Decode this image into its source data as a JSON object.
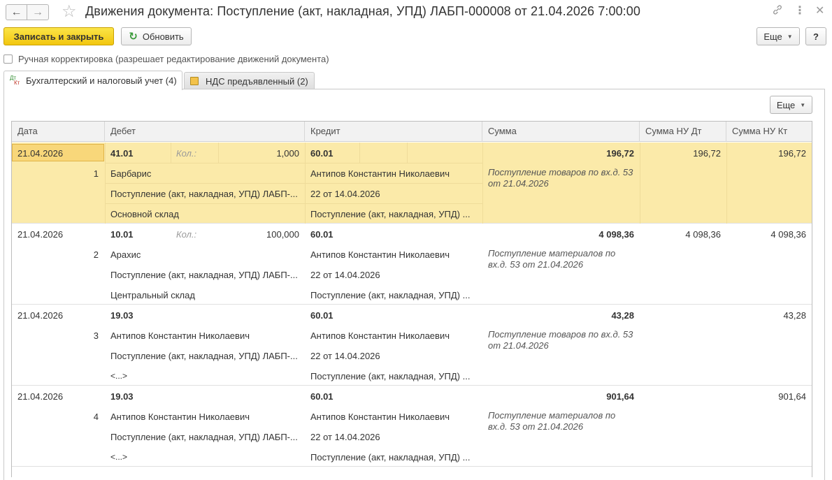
{
  "window": {
    "title": "Движения документа: Поступление (акт, накладная, УПД) ЛАБП-000008 от 21.04.2026 7:00:00",
    "back_glyph": "←",
    "forward_glyph": "→",
    "icons": [
      "favorite-star-icon",
      "link-icon",
      "more-vertical-icon",
      "close-icon"
    ]
  },
  "toolbar": {
    "save_close_label": "Записать и закрыть",
    "refresh_label": "Обновить",
    "more_label": "Еще",
    "help_label": "?"
  },
  "manual_correction": {
    "label": "Ручная корректировка (разрешает редактирование движений документа)",
    "checked": false
  },
  "tabs": [
    {
      "label": "Бухгалтерский и налоговый учет (4)",
      "icon_d": "Дт",
      "icon_k": "Кт",
      "active": true
    },
    {
      "label": "НДС предъявленный (2)",
      "active": false
    }
  ],
  "table_toolbar": {
    "more_label": "Еще"
  },
  "columns": {
    "date": "Дата",
    "debit": "Дебет",
    "credit": "Кредит",
    "sum": "Сумма",
    "sum_nu_dt": "Сумма НУ Дт",
    "sum_nu_kt": "Сумма НУ Кт"
  },
  "rows": [
    {
      "date": "21.04.2026",
      "num": "1",
      "debit_account": "41.01",
      "qty_label": "Кол.:",
      "qty": "1,000",
      "debit_sub1": "Барбарис",
      "debit_sub2": "Поступление (акт, накладная, УПД) ЛАБП-...",
      "debit_sub3": "Основной склад",
      "credit_account": "60.01",
      "credit_sub1": "Антипов Константин Николаевич",
      "credit_sub2": "22 от 14.04.2026",
      "credit_sub3": "Поступление (акт, накладная, УПД) ...",
      "sum": "196,72",
      "content": "Поступление товаров по вх.д. 53 от 21.04.2026",
      "sum_nu_dt": "196,72",
      "sum_nu_kt": "196,72",
      "selected": true
    },
    {
      "date": "21.04.2026",
      "num": "2",
      "debit_account": "10.01",
      "qty_label": "Кол.:",
      "qty": "100,000",
      "debit_sub1": "Арахис",
      "debit_sub2": "Поступление (акт, накладная, УПД) ЛАБП-...",
      "debit_sub3": "Центральный склад",
      "credit_account": "60.01",
      "credit_sub1": "Антипов Константин Николаевич",
      "credit_sub2": "22 от 14.04.2026",
      "credit_sub3": "Поступление (акт, накладная, УПД) ...",
      "sum": "4 098,36",
      "content": "Поступление материалов по вх.д. 53 от 21.04.2026",
      "sum_nu_dt": "4 098,36",
      "sum_nu_kt": "4 098,36",
      "selected": false
    },
    {
      "date": "21.04.2026",
      "num": "3",
      "debit_account": "19.03",
      "qty_label": "",
      "qty": "",
      "debit_sub1": "Антипов Константин Николаевич",
      "debit_sub2": "Поступление (акт, накладная, УПД) ЛАБП-...",
      "debit_sub3": "<...>",
      "credit_account": "60.01",
      "credit_sub1": "Антипов Константин Николаевич",
      "credit_sub2": "22 от 14.04.2026",
      "credit_sub3": "Поступление (акт, накладная, УПД) ...",
      "sum": "43,28",
      "content": "Поступление товаров по вх.д. 53 от 21.04.2026",
      "sum_nu_dt": "",
      "sum_nu_kt": "43,28",
      "selected": false
    },
    {
      "date": "21.04.2026",
      "num": "4",
      "debit_account": "19.03",
      "qty_label": "",
      "qty": "",
      "debit_sub1": "Антипов Константин Николаевич",
      "debit_sub2": "Поступление (акт, накладная, УПД) ЛАБП-...",
      "debit_sub3": "<...>",
      "credit_account": "60.01",
      "credit_sub1": "Антипов Константин Николаевич",
      "credit_sub2": "22 от 14.04.2026",
      "credit_sub3": "Поступление (акт, накладная, УПД) ...",
      "sum": "901,64",
      "content": "Поступление материалов по вх.д. 53 от 21.04.2026",
      "sum_nu_dt": "",
      "sum_nu_kt": "901,64",
      "selected": false
    }
  ],
  "colors": {
    "primary_button": "#f2c60f",
    "selected_row": "#fbeaa9",
    "header_bg": "#f2f2f2"
  }
}
